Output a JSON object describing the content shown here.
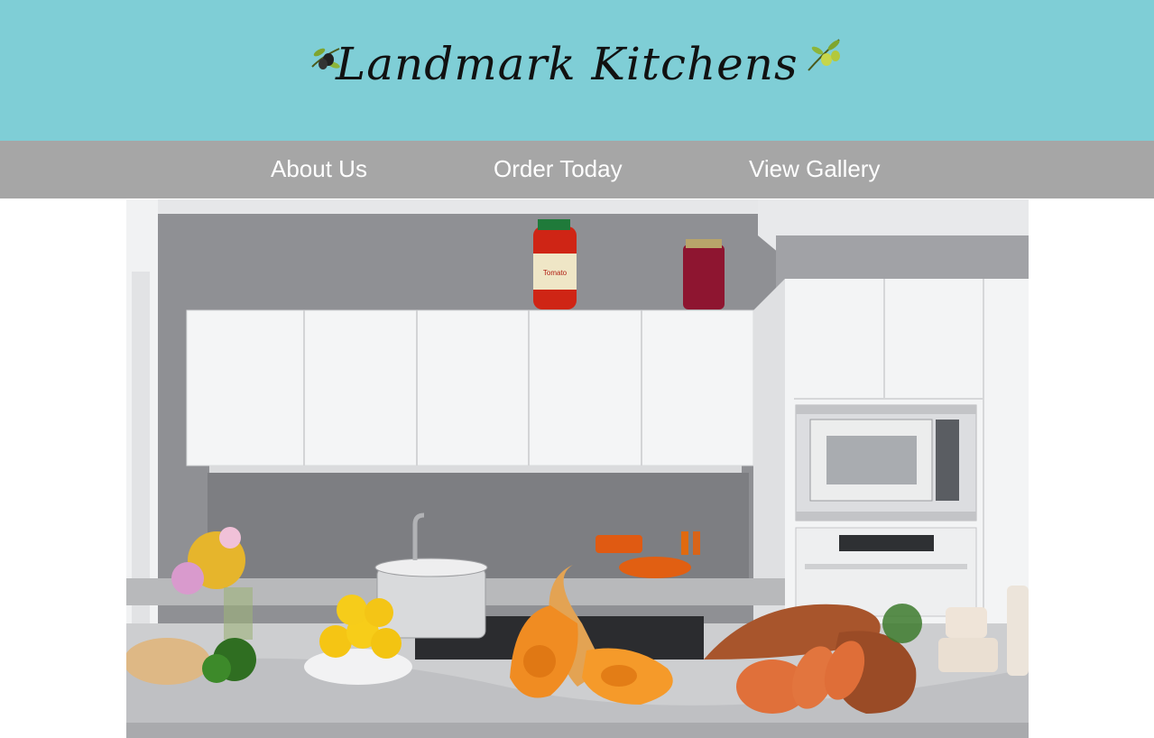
{
  "site": {
    "logo_text": "Landmark Kitchens"
  },
  "nav": {
    "items": [
      {
        "label": "About Us"
      },
      {
        "label": "Order Today"
      },
      {
        "label": "View Gallery"
      }
    ]
  },
  "colors": {
    "header_bg": "#7fced6",
    "nav_bg": "#a6a6a6",
    "nav_text": "#ffffff"
  },
  "hero": {
    "jar_label": "Tomato"
  }
}
